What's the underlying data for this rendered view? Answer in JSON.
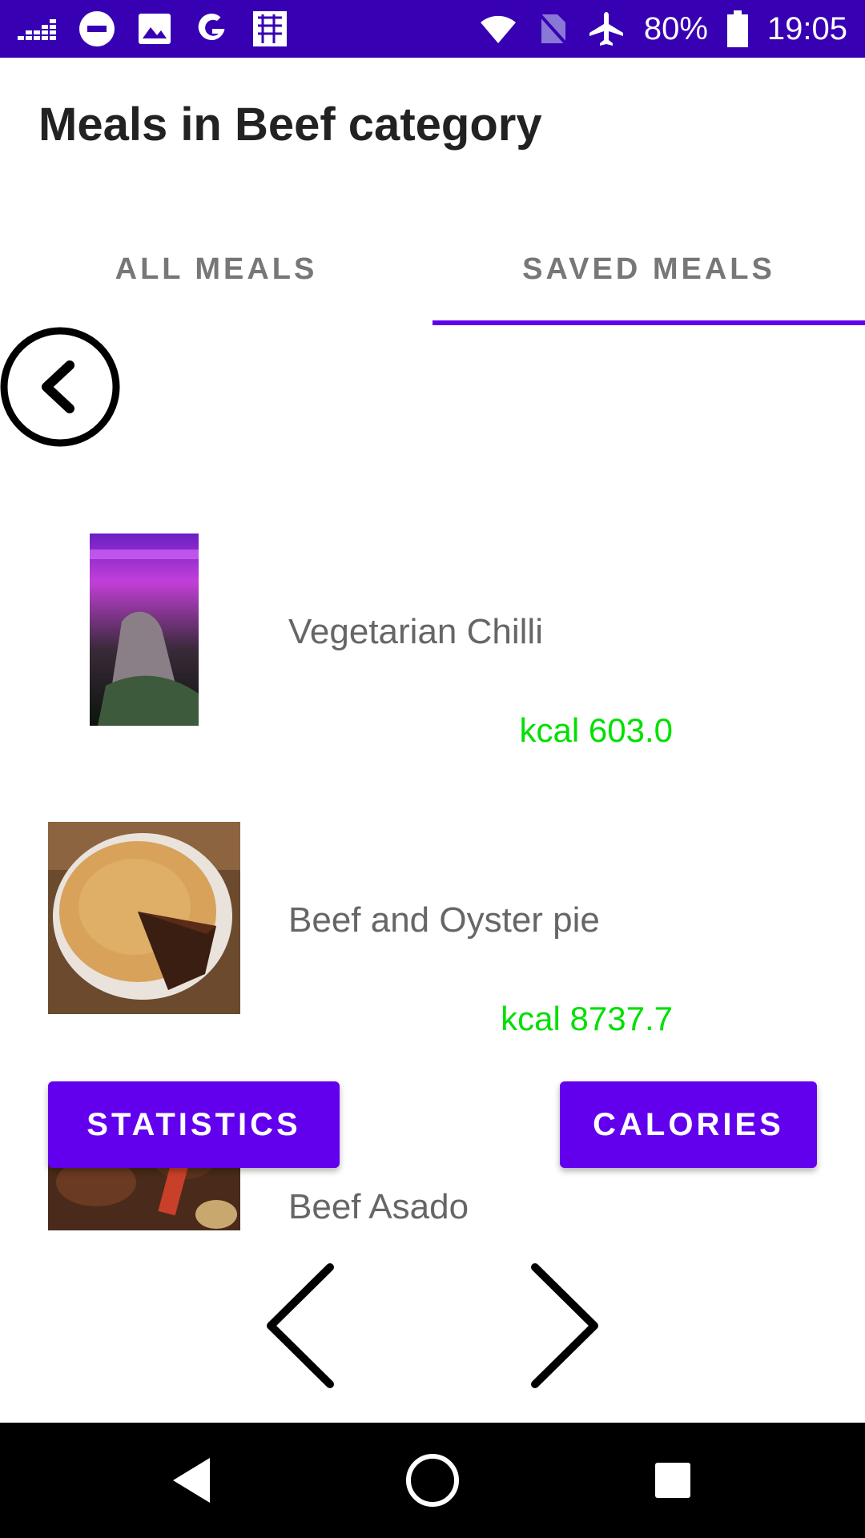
{
  "status_bar": {
    "battery": "80%",
    "time": "19:05",
    "left_icons": [
      "deezer-icon",
      "do-not-disturb-icon",
      "image-icon",
      "google-icon",
      "app-icon"
    ],
    "right_icons": [
      "wifi-icon",
      "no-sim-icon",
      "airplane-icon",
      "battery-icon"
    ]
  },
  "header": {
    "title": "Meals in Beef category"
  },
  "tabs": [
    {
      "label": "ALL MEALS",
      "selected": false
    },
    {
      "label": "SAVED MEALS",
      "selected": true
    }
  ],
  "meals": [
    {
      "name": "Vegetarian Chilli",
      "kcal": "kcal 603.0"
    },
    {
      "name": "Beef and Oyster pie",
      "kcal": "kcal 8737.7"
    },
    {
      "name": "Beef Asado",
      "kcal": ""
    }
  ],
  "buttons": {
    "statistics": "STATISTICS",
    "calories": "CALORIES"
  },
  "colors": {
    "accent": "#6200ee",
    "status_bar": "#3700b3",
    "kcal": "#00e000"
  }
}
